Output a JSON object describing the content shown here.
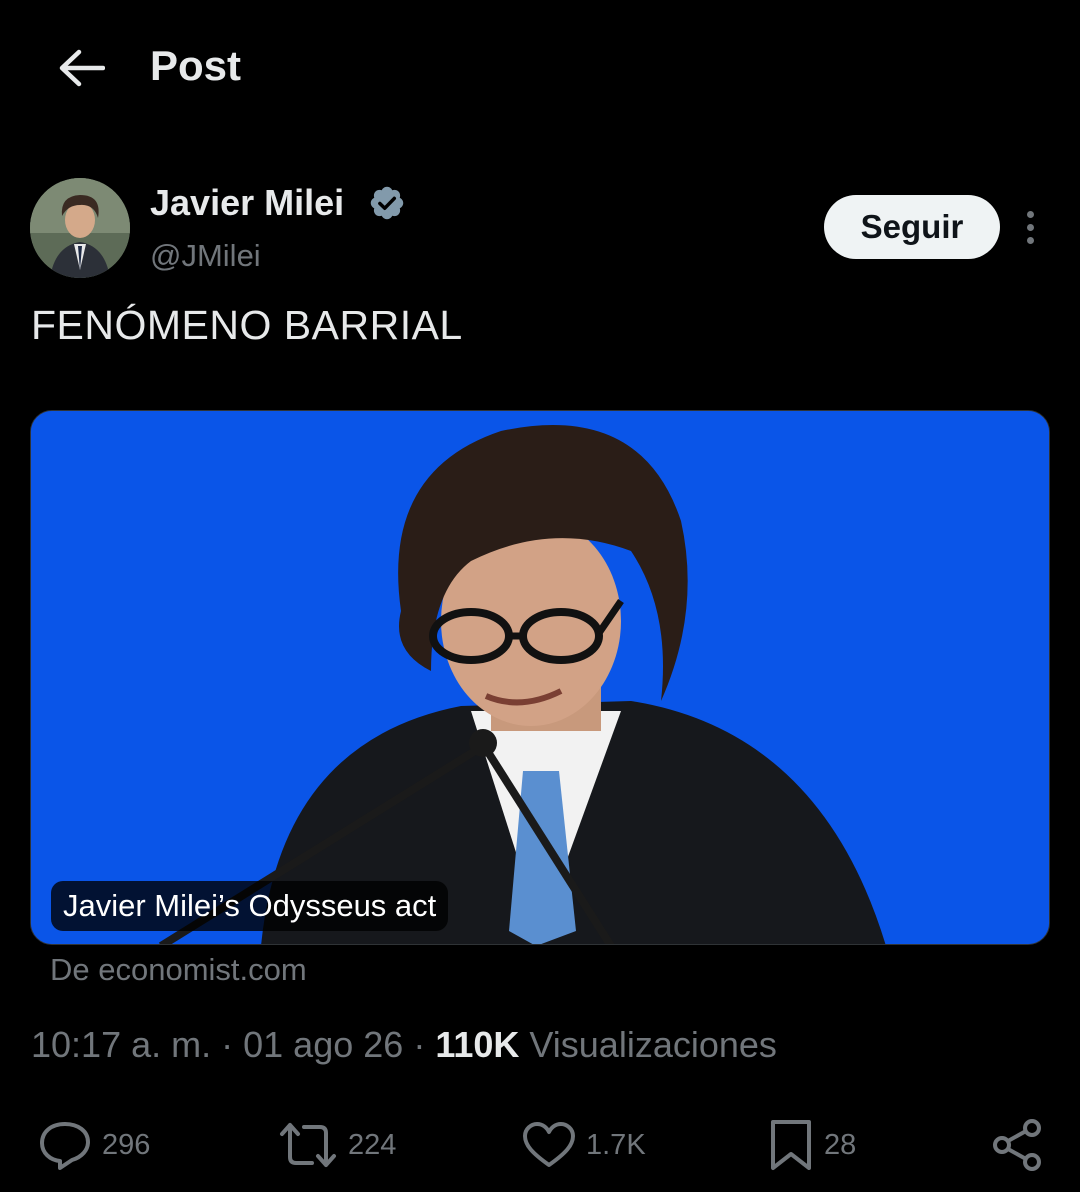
{
  "header": {
    "title": "Post",
    "back_icon": "arrow-left-icon"
  },
  "author": {
    "name": "Javier Milei",
    "handle": "@JMilei",
    "verified": true,
    "verified_color": "#829aab"
  },
  "actions_top": {
    "follow_label": "Seguir",
    "more_icon": "more-vertical-icon"
  },
  "post": {
    "text": "FENÓMENO BARRIAL",
    "card": {
      "caption": "Javier Milei’s Odysseus act",
      "background_color": "#0a55e8"
    },
    "source": "De economist.com",
    "time": "10:17 a. m.",
    "date": "01 ago 26",
    "separator": "·",
    "views_count": "110K",
    "views_label": "Visualizaciones"
  },
  "engagement": {
    "replies": "296",
    "reposts": "224",
    "likes": "1.7K",
    "bookmarks": "28"
  },
  "colors": {
    "background": "#000000",
    "primary_text": "#e7e9ea",
    "secondary_text": "#71767b",
    "follow_bg": "#eff3f4"
  }
}
